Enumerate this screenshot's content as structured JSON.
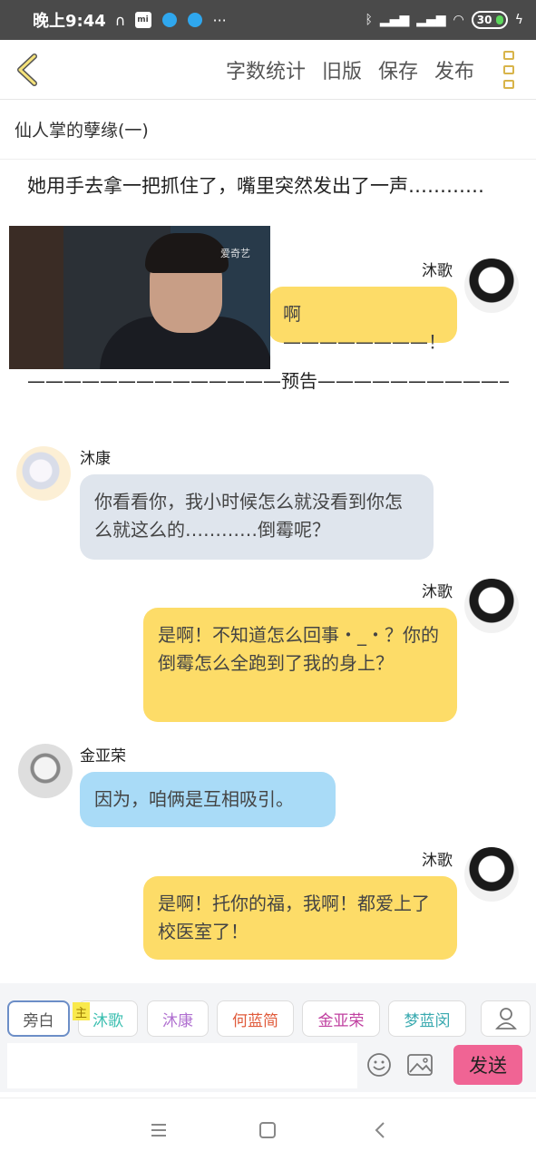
{
  "status_bar": {
    "time": "晚上9:44",
    "battery": "30"
  },
  "toolbar": {
    "word_count": "字数统计",
    "old_version": "旧版",
    "save": "保存",
    "publish": "发布"
  },
  "story": {
    "title": "仙人掌的孽缘(一)",
    "narration": "她用手去拿一把抓住了，嘴里突然发出了一声…………",
    "divider": "——————————————预告——————————————",
    "video_watermark": "爱奇艺"
  },
  "messages": [
    {
      "speaker": "沐歌",
      "text": "啊————————！"
    },
    {
      "speaker": "沐康",
      "text": "你看看你，我小时候怎么就没看到你怎么就这么的…………倒霉呢？"
    },
    {
      "speaker": "沐歌",
      "text": "是啊！不知道怎么回事・_・？你的倒霉怎么全跑到了我的身上？"
    },
    {
      "speaker": "金亚荣",
      "text": "因为，咱俩是互相吸引。"
    },
    {
      "speaker": "沐歌",
      "text": "是啊！托你的福，我啊！都爱上了校医室了！"
    }
  ],
  "composer": {
    "roles": [
      {
        "label": "旁白",
        "color": "#555555"
      },
      {
        "label": "沐歌",
        "color": "#3bbfb0"
      },
      {
        "label": "沐康",
        "color": "#b070d0"
      },
      {
        "label": "何蓝简",
        "color": "#e05a3a"
      },
      {
        "label": "金亚荣",
        "color": "#c040a0"
      },
      {
        "label": "梦蓝闵",
        "color": "#3aaab0"
      }
    ],
    "host_tag": "主",
    "send": "发送",
    "input_value": ""
  }
}
